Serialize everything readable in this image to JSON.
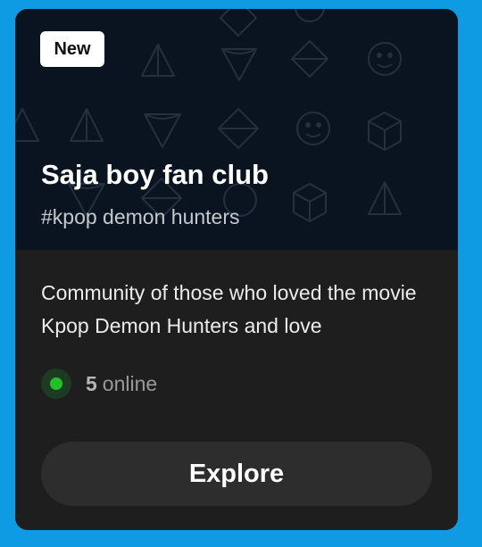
{
  "card": {
    "badge": "New",
    "title": "Saja boy fan club",
    "tag": "#kpop demon hunters",
    "description": "Community of those who loved the movie Kpop Demon Hunters and love",
    "online_count": "5",
    "online_label": "online",
    "explore_label": "Explore"
  },
  "colors": {
    "page_background": "#0f9be4",
    "header_background": "#0a1420",
    "card_background": "#1e1e1e",
    "online_dot": "#22c12a",
    "button_background": "#2d2d2d"
  },
  "icons": {
    "header_pattern": "geometric-dice-pattern",
    "status": "online-status-dot-icon"
  }
}
